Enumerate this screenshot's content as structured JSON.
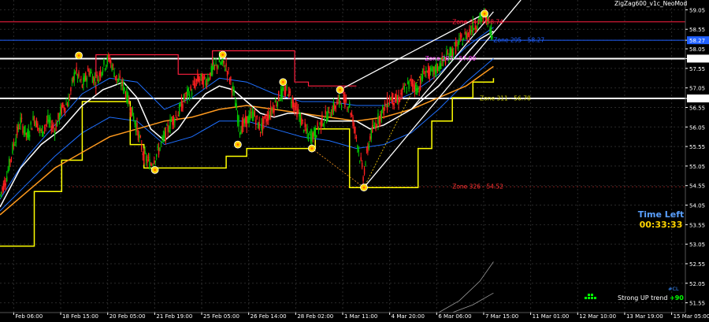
{
  "chart_title": "ZigZag600_v1c_NeoMod",
  "symbol_label": "#CL",
  "time_left": {
    "label": "Time Left",
    "value": "00:33:33"
  },
  "trend": {
    "label": "Strong UP trend",
    "value": "+90"
  },
  "colors": {
    "candle_up": "#00c800",
    "candle_down": "#ff2020",
    "ma_white": "#ffffff",
    "ma_orange": "#ff9a1e",
    "band_blue": "#1e6fff",
    "zigzag_dot": "#ffd400",
    "stop_yellow": "#ffff00",
    "stop_red": "#ff2040",
    "hline_white": "#ffffff",
    "hline_blue": "#2060ff",
    "hline_red": "#ff2040",
    "grid": "#2a2a2a"
  },
  "chart_data": {
    "type": "line",
    "ylim": [
      51.3,
      59.3
    ],
    "y_ticks": [
      "59.05",
      "58.55",
      "58.27",
      "58.05",
      "57.80",
      "57.55",
      "57.05",
      "56.78",
      "56.55",
      "56.05",
      "55.55",
      "55.05",
      "54.55",
      "54.05",
      "53.55",
      "53.05",
      "52.55",
      "52.05",
      "51.55"
    ],
    "x_ticks": [
      "Feb 06:00",
      "18 Feb 15:00",
      "20 Feb 05:00",
      "21 Feb 19:00",
      "25 Feb 05:00",
      "26 Feb 14:00",
      "28 Feb 02:00",
      "1 Mar 11:00",
      "4 Mar 20:00",
      "6 Mar 06:00",
      "7 Mar 15:00",
      "11 Mar 01:00",
      "12 Mar 10:00",
      "13 Mar 19:00",
      "15 Mar 05:00"
    ],
    "highlighted_levels": [
      {
        "value": 58.27,
        "label": "58.27",
        "color": "#2060ff"
      },
      {
        "value": 57.8,
        "label": "57.80",
        "color": "#ffffff"
      },
      {
        "value": 56.78,
        "label": "56.78",
        "color": "#ffffff"
      }
    ],
    "zones": [
      {
        "label": "Zone 340 - 58.74",
        "value": 58.74,
        "color": "#ff2040"
      },
      {
        "label": "Zone 295 - 58.27",
        "value": 58.27,
        "color": "#2060ff"
      },
      {
        "label": "Zone 287 - 57.80",
        "value": 57.8,
        "color": "#ff40ff"
      },
      {
        "label": "Zone 311 - 56.78",
        "value": 56.78,
        "color": "#cccc00"
      },
      {
        "label": "Zone 326 - 54.52",
        "value": 54.52,
        "color": "#ff3030"
      }
    ],
    "zigzag_points": [
      {
        "x": 0.115,
        "y": 57.88
      },
      {
        "x": 0.226,
        "y": 54.95
      },
      {
        "x": 0.325,
        "y": 57.9
      },
      {
        "x": 0.347,
        "y": 55.6
      },
      {
        "x": 0.413,
        "y": 57.2
      },
      {
        "x": 0.455,
        "y": 55.5
      },
      {
        "x": 0.496,
        "y": 57.0
      },
      {
        "x": 0.531,
        "y": 54.5
      },
      {
        "x": 0.707,
        "y": 58.95
      }
    ],
    "price_series": [
      [
        0.0,
        54.3
      ],
      [
        0.01,
        54.8
      ],
      [
        0.02,
        55.6
      ],
      [
        0.03,
        56.2
      ],
      [
        0.04,
        55.8
      ],
      [
        0.05,
        56.3
      ],
      [
        0.06,
        55.9
      ],
      [
        0.07,
        56.2
      ],
      [
        0.08,
        56.0
      ],
      [
        0.09,
        56.5
      ],
      [
        0.1,
        56.7
      ],
      [
        0.11,
        57.5
      ],
      [
        0.12,
        57.1
      ],
      [
        0.13,
        57.5
      ],
      [
        0.14,
        57.2
      ],
      [
        0.15,
        57.6
      ],
      [
        0.16,
        57.8
      ],
      [
        0.17,
        57.3
      ],
      [
        0.18,
        57.1
      ],
      [
        0.19,
        56.6
      ],
      [
        0.2,
        56.0
      ],
      [
        0.21,
        55.3
      ],
      [
        0.22,
        55.1
      ],
      [
        0.23,
        55.4
      ],
      [
        0.24,
        55.8
      ],
      [
        0.25,
        56.2
      ],
      [
        0.26,
        56.4
      ],
      [
        0.27,
        56.8
      ],
      [
        0.28,
        57.0
      ],
      [
        0.29,
        57.3
      ],
      [
        0.3,
        57.2
      ],
      [
        0.31,
        57.5
      ],
      [
        0.32,
        57.7
      ],
      [
        0.33,
        57.6
      ],
      [
        0.34,
        57.0
      ],
      [
        0.35,
        56.0
      ],
      [
        0.36,
        56.2
      ],
      [
        0.37,
        56.4
      ],
      [
        0.38,
        56.0
      ],
      [
        0.39,
        56.3
      ],
      [
        0.4,
        56.6
      ],
      [
        0.41,
        56.9
      ],
      [
        0.42,
        57.0
      ],
      [
        0.43,
        56.6
      ],
      [
        0.44,
        56.2
      ],
      [
        0.45,
        55.8
      ],
      [
        0.46,
        55.9
      ],
      [
        0.47,
        56.2
      ],
      [
        0.48,
        56.4
      ],
      [
        0.49,
        56.6
      ],
      [
        0.5,
        56.8
      ],
      [
        0.51,
        56.6
      ],
      [
        0.52,
        55.8
      ],
      [
        0.53,
        54.8
      ],
      [
        0.54,
        55.8
      ],
      [
        0.55,
        56.2
      ],
      [
        0.56,
        56.5
      ],
      [
        0.57,
        56.8
      ],
      [
        0.58,
        56.7
      ],
      [
        0.59,
        57.0
      ],
      [
        0.6,
        57.2
      ],
      [
        0.61,
        57.0
      ],
      [
        0.62,
        57.5
      ],
      [
        0.63,
        57.4
      ],
      [
        0.64,
        57.6
      ],
      [
        0.65,
        57.8
      ],
      [
        0.66,
        58.0
      ],
      [
        0.67,
        58.2
      ],
      [
        0.68,
        58.4
      ],
      [
        0.69,
        58.6
      ],
      [
        0.7,
        58.8
      ],
      [
        0.71,
        58.9
      ],
      [
        0.72,
        58.3
      ]
    ],
    "ma_white": [
      [
        0.0,
        54.0
      ],
      [
        0.03,
        55.0
      ],
      [
        0.06,
        55.6
      ],
      [
        0.09,
        56.0
      ],
      [
        0.12,
        56.6
      ],
      [
        0.15,
        57.0
      ],
      [
        0.18,
        57.2
      ],
      [
        0.2,
        56.8
      ],
      [
        0.22,
        56.0
      ],
      [
        0.24,
        55.7
      ],
      [
        0.26,
        56.0
      ],
      [
        0.28,
        56.5
      ],
      [
        0.3,
        56.9
      ],
      [
        0.32,
        57.1
      ],
      [
        0.34,
        57.0
      ],
      [
        0.36,
        56.7
      ],
      [
        0.38,
        56.4
      ],
      [
        0.4,
        56.3
      ],
      [
        0.42,
        56.4
      ],
      [
        0.44,
        56.4
      ],
      [
        0.46,
        56.3
      ],
      [
        0.48,
        56.2
      ],
      [
        0.5,
        56.2
      ],
      [
        0.52,
        56.2
      ],
      [
        0.54,
        56.0
      ],
      [
        0.56,
        56.1
      ],
      [
        0.58,
        56.3
      ],
      [
        0.6,
        56.5
      ],
      [
        0.62,
        56.8
      ],
      [
        0.64,
        57.1
      ],
      [
        0.66,
        57.5
      ],
      [
        0.68,
        57.9
      ],
      [
        0.7,
        58.3
      ],
      [
        0.72,
        58.5
      ]
    ],
    "ma_orange": [
      [
        0.0,
        53.8
      ],
      [
        0.04,
        54.4
      ],
      [
        0.08,
        55.0
      ],
      [
        0.12,
        55.4
      ],
      [
        0.16,
        55.8
      ],
      [
        0.2,
        56.0
      ],
      [
        0.24,
        56.2
      ],
      [
        0.28,
        56.3
      ],
      [
        0.32,
        56.5
      ],
      [
        0.36,
        56.6
      ],
      [
        0.4,
        56.5
      ],
      [
        0.44,
        56.4
      ],
      [
        0.48,
        56.3
      ],
      [
        0.52,
        56.2
      ],
      [
        0.56,
        56.3
      ],
      [
        0.6,
        56.5
      ],
      [
        0.64,
        56.8
      ],
      [
        0.68,
        57.1
      ],
      [
        0.72,
        57.6
      ]
    ],
    "band_upper": [
      [
        0.0,
        54.2
      ],
      [
        0.04,
        55.3
      ],
      [
        0.08,
        56.1
      ],
      [
        0.12,
        56.9
      ],
      [
        0.16,
        57.3
      ],
      [
        0.2,
        57.2
      ],
      [
        0.24,
        56.5
      ],
      [
        0.28,
        56.8
      ],
      [
        0.32,
        57.3
      ],
      [
        0.36,
        57.2
      ],
      [
        0.4,
        56.9
      ],
      [
        0.44,
        56.7
      ],
      [
        0.48,
        56.7
      ],
      [
        0.52,
        56.6
      ],
      [
        0.56,
        56.6
      ],
      [
        0.6,
        56.9
      ],
      [
        0.64,
        57.4
      ],
      [
        0.68,
        58.1
      ],
      [
        0.72,
        58.6
      ]
    ],
    "band_lower": [
      [
        0.0,
        53.9
      ],
      [
        0.04,
        54.6
      ],
      [
        0.08,
        55.3
      ],
      [
        0.12,
        55.9
      ],
      [
        0.16,
        56.3
      ],
      [
        0.2,
        56.2
      ],
      [
        0.24,
        55.6
      ],
      [
        0.28,
        55.8
      ],
      [
        0.32,
        56.2
      ],
      [
        0.36,
        56.2
      ],
      [
        0.4,
        56.0
      ],
      [
        0.44,
        55.8
      ],
      [
        0.48,
        55.7
      ],
      [
        0.52,
        55.5
      ],
      [
        0.56,
        55.6
      ],
      [
        0.6,
        55.9
      ],
      [
        0.64,
        56.5
      ],
      [
        0.68,
        57.2
      ],
      [
        0.72,
        57.8
      ]
    ],
    "stop_yellow": [
      [
        0.0,
        53.0
      ],
      [
        0.05,
        53.0
      ],
      [
        0.05,
        54.4
      ],
      [
        0.09,
        54.4
      ],
      [
        0.09,
        55.2
      ],
      [
        0.12,
        55.2
      ],
      [
        0.12,
        56.7
      ],
      [
        0.19,
        56.7
      ],
      [
        0.19,
        55.6
      ],
      [
        0.21,
        55.6
      ],
      [
        0.21,
        55.0
      ],
      [
        0.33,
        55.0
      ],
      [
        0.33,
        55.3
      ],
      [
        0.36,
        55.3
      ],
      [
        0.36,
        55.5
      ],
      [
        0.46,
        55.5
      ],
      [
        0.46,
        56.0
      ],
      [
        0.51,
        56.0
      ],
      [
        0.51,
        54.5
      ],
      [
        0.61,
        54.5
      ],
      [
        0.61,
        55.5
      ],
      [
        0.63,
        55.5
      ],
      [
        0.63,
        56.2
      ],
      [
        0.66,
        56.2
      ],
      [
        0.66,
        56.8
      ],
      [
        0.69,
        56.8
      ],
      [
        0.69,
        57.2
      ],
      [
        0.72,
        57.2
      ],
      [
        0.72,
        57.3
      ]
    ],
    "stop_red": [
      [
        0.14,
        57.3
      ],
      [
        0.14,
        57.9
      ],
      [
        0.26,
        57.9
      ],
      [
        0.26,
        57.4
      ],
      [
        0.31,
        57.4
      ],
      [
        0.31,
        58.0
      ],
      [
        0.43,
        58.0
      ],
      [
        0.43,
        57.2
      ],
      [
        0.45,
        57.2
      ],
      [
        0.45,
        57.1
      ],
      [
        0.52,
        57.1
      ]
    ],
    "trend_lines": [
      {
        "from": [
          0.531,
          54.5
        ],
        "to": [
          0.76,
          59.3
        ]
      },
      {
        "from": [
          0.496,
          57.0
        ],
        "to": [
          0.707,
          58.95
        ]
      },
      {
        "from": [
          0.6,
          56.5
        ],
        "to": [
          0.72,
          59.0
        ]
      }
    ],
    "lower_curves": [
      [
        [
          0.64,
          51.3
        ],
        [
          0.67,
          51.6
        ],
        [
          0.7,
          52.1
        ],
        [
          0.72,
          52.6
        ]
      ],
      [
        [
          0.66,
          51.3
        ],
        [
          0.69,
          51.5
        ],
        [
          0.72,
          51.8
        ]
      ]
    ]
  }
}
